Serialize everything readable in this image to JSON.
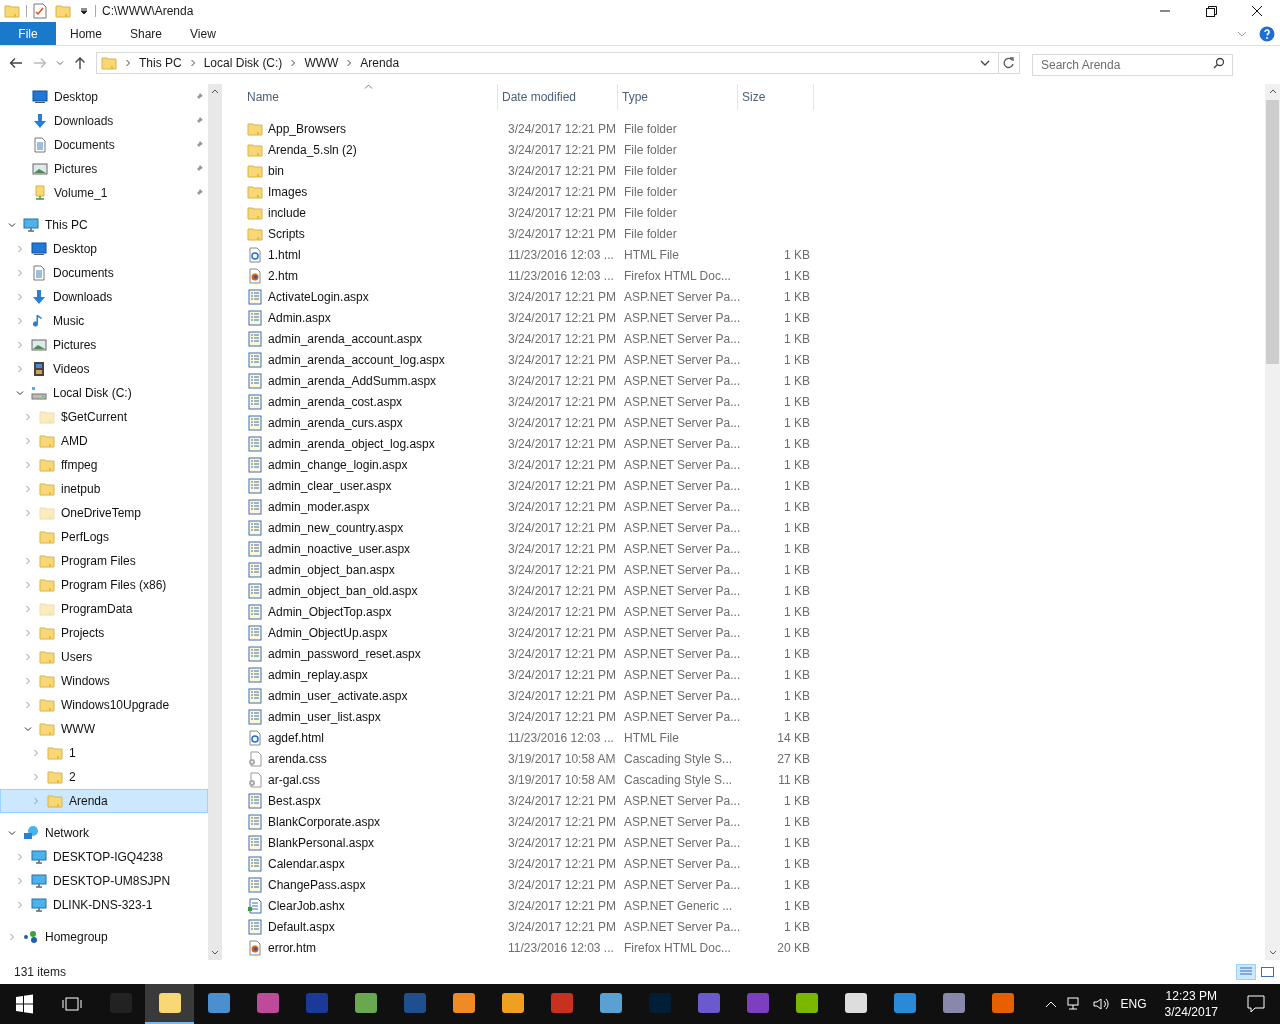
{
  "window": {
    "title": "C:\\WWW\\Arenda"
  },
  "ribbon_tabs": [
    {
      "label": "File",
      "selected": true
    },
    {
      "label": "Home",
      "selected": false
    },
    {
      "label": "Share",
      "selected": false
    },
    {
      "label": "View",
      "selected": false
    }
  ],
  "address": {
    "crumbs": [
      "This PC",
      "Local Disk (C:)",
      "WWW",
      "Arenda"
    ]
  },
  "search": {
    "placeholder": "Search Arenda"
  },
  "quick_access": [
    {
      "label": "Desktop",
      "kind": "desktop",
      "pinned": true
    },
    {
      "label": "Downloads",
      "kind": "downloads",
      "pinned": true
    },
    {
      "label": "Documents",
      "kind": "documents",
      "pinned": true
    },
    {
      "label": "Pictures",
      "kind": "pictures",
      "pinned": true
    },
    {
      "label": "Volume_1",
      "kind": "volume",
      "pinned": true
    }
  ],
  "tree": [
    {
      "label": "This PC",
      "kind": "pc",
      "expanded": true,
      "selected": false,
      "children": [
        {
          "label": "Desktop",
          "kind": "desktop",
          "expanded": false,
          "selected": false
        },
        {
          "label": "Documents",
          "kind": "documents",
          "expanded": false,
          "selected": false
        },
        {
          "label": "Downloads",
          "kind": "downloads",
          "expanded": false,
          "selected": false
        },
        {
          "label": "Music",
          "kind": "music",
          "expanded": false,
          "selected": false
        },
        {
          "label": "Pictures",
          "kind": "pictures",
          "expanded": false,
          "selected": false
        },
        {
          "label": "Videos",
          "kind": "videos",
          "expanded": false,
          "selected": false
        },
        {
          "label": "Local Disk (C:)",
          "kind": "drive",
          "expanded": true,
          "selected": false,
          "children": [
            {
              "label": "$GetCurrent",
              "kind": "folder",
              "hidden": true,
              "expanded": false,
              "selected": false
            },
            {
              "label": "AMD",
              "kind": "folder",
              "hidden": false,
              "expanded": false,
              "selected": false
            },
            {
              "label": "ffmpeg",
              "kind": "folder",
              "hidden": false,
              "expanded": false,
              "selected": false
            },
            {
              "label": "inetpub",
              "kind": "folder",
              "hidden": false,
              "expanded": false,
              "selected": false
            },
            {
              "label": "OneDriveTemp",
              "kind": "folder",
              "hidden": true,
              "expanded": false,
              "selected": false
            },
            {
              "label": "PerfLogs",
              "kind": "folder",
              "hidden": false,
              "selected": false
            },
            {
              "label": "Program Files",
              "kind": "folder",
              "hidden": false,
              "expanded": false,
              "selected": false
            },
            {
              "label": "Program Files (x86)",
              "kind": "folder",
              "hidden": false,
              "expanded": false,
              "selected": false
            },
            {
              "label": "ProgramData",
              "kind": "folder",
              "hidden": true,
              "expanded": false,
              "selected": false
            },
            {
              "label": "Projects",
              "kind": "folder",
              "hidden": false,
              "expanded": false,
              "selected": false
            },
            {
              "label": "Users",
              "kind": "folder",
              "hidden": false,
              "expanded": false,
              "selected": false
            },
            {
              "label": "Windows",
              "kind": "folder",
              "hidden": false,
              "expanded": false,
              "selected": false
            },
            {
              "label": "Windows10Upgrade",
              "kind": "folder",
              "hidden": false,
              "expanded": false,
              "selected": false
            },
            {
              "label": "WWW",
              "kind": "folder",
              "hidden": false,
              "expanded": true,
              "selected": false,
              "children": [
                {
                  "label": "1",
                  "kind": "folder",
                  "hidden": false,
                  "expanded": false,
                  "selected": false
                },
                {
                  "label": "2",
                  "kind": "folder",
                  "hidden": false,
                  "expanded": false,
                  "selected": false
                },
                {
                  "label": "Arenda",
                  "kind": "folder",
                  "hidden": false,
                  "expanded": false,
                  "selected": true
                }
              ]
            }
          ]
        }
      ]
    },
    {
      "label": "Network",
      "kind": "network",
      "expanded": true,
      "selected": false,
      "children": [
        {
          "label": "DESKTOP-IGQ4238",
          "kind": "computer",
          "expanded": false,
          "selected": false
        },
        {
          "label": "DESKTOP-UM8SJPN",
          "kind": "computer",
          "expanded": false,
          "selected": false
        },
        {
          "label": "DLINK-DNS-323-1",
          "kind": "computer",
          "expanded": false,
          "selected": false
        }
      ]
    },
    {
      "label": "Homegroup",
      "kind": "homegroup",
      "expanded": false,
      "selected": false
    }
  ],
  "columns": [
    "Name",
    "Date modified",
    "Type",
    "Size"
  ],
  "files": [
    {
      "kind": "folder",
      "name": "App_Browsers",
      "date": "3/24/2017 12:21 PM",
      "type": "File folder"
    },
    {
      "kind": "folder",
      "name": "Arenda_5.sln (2)",
      "date": "3/24/2017 12:21 PM",
      "type": "File folder"
    },
    {
      "kind": "folder",
      "name": "bin",
      "date": "3/24/2017 12:21 PM",
      "type": "File folder"
    },
    {
      "kind": "folder",
      "name": "Images",
      "date": "3/24/2017 12:21 PM",
      "type": "File folder"
    },
    {
      "kind": "folder",
      "name": "include",
      "date": "3/24/2017 12:21 PM",
      "type": "File folder"
    },
    {
      "kind": "folder",
      "name": "Scripts",
      "date": "3/24/2017 12:21 PM",
      "type": "File folder"
    },
    {
      "kind": "html",
      "name": "1.html",
      "date": "11/23/2016 12:03 ...",
      "type": "HTML File",
      "size": "1 KB"
    },
    {
      "kind": "firefox",
      "name": "2.htm",
      "date": "11/23/2016 12:03 ...",
      "type": "Firefox HTML Doc...",
      "size": "1 KB"
    },
    {
      "kind": "aspx",
      "name": "ActivateLogin.aspx",
      "date": "3/24/2017 12:21 PM",
      "type": "ASP.NET Server Pa...",
      "size": "1 KB"
    },
    {
      "kind": "aspx",
      "name": "Admin.aspx",
      "date": "3/24/2017 12:21 PM",
      "type": "ASP.NET Server Pa...",
      "size": "1 KB"
    },
    {
      "kind": "aspx",
      "name": "admin_arenda_account.aspx",
      "date": "3/24/2017 12:21 PM",
      "type": "ASP.NET Server Pa...",
      "size": "1 KB"
    },
    {
      "kind": "aspx",
      "name": "admin_arenda_account_log.aspx",
      "date": "3/24/2017 12:21 PM",
      "type": "ASP.NET Server Pa...",
      "size": "1 KB"
    },
    {
      "kind": "aspx",
      "name": "admin_arenda_AddSumm.aspx",
      "date": "3/24/2017 12:21 PM",
      "type": "ASP.NET Server Pa...",
      "size": "1 KB"
    },
    {
      "kind": "aspx",
      "name": "admin_arenda_cost.aspx",
      "date": "3/24/2017 12:21 PM",
      "type": "ASP.NET Server Pa...",
      "size": "1 KB"
    },
    {
      "kind": "aspx",
      "name": "admin_arenda_curs.aspx",
      "date": "3/24/2017 12:21 PM",
      "type": "ASP.NET Server Pa...",
      "size": "1 KB"
    },
    {
      "kind": "aspx",
      "name": "admin_arenda_object_log.aspx",
      "date": "3/24/2017 12:21 PM",
      "type": "ASP.NET Server Pa...",
      "size": "1 KB"
    },
    {
      "kind": "aspx",
      "name": "admin_change_login.aspx",
      "date": "3/24/2017 12:21 PM",
      "type": "ASP.NET Server Pa...",
      "size": "1 KB"
    },
    {
      "kind": "aspx",
      "name": "admin_clear_user.aspx",
      "date": "3/24/2017 12:21 PM",
      "type": "ASP.NET Server Pa...",
      "size": "1 KB"
    },
    {
      "kind": "aspx",
      "name": "admin_moder.aspx",
      "date": "3/24/2017 12:21 PM",
      "type": "ASP.NET Server Pa...",
      "size": "1 KB"
    },
    {
      "kind": "aspx",
      "name": "admin_new_country.aspx",
      "date": "3/24/2017 12:21 PM",
      "type": "ASP.NET Server Pa...",
      "size": "1 KB"
    },
    {
      "kind": "aspx",
      "name": "admin_noactive_user.aspx",
      "date": "3/24/2017 12:21 PM",
      "type": "ASP.NET Server Pa...",
      "size": "1 KB"
    },
    {
      "kind": "aspx",
      "name": "admin_object_ban.aspx",
      "date": "3/24/2017 12:21 PM",
      "type": "ASP.NET Server Pa...",
      "size": "1 KB"
    },
    {
      "kind": "aspx",
      "name": "admin_object_ban_old.aspx",
      "date": "3/24/2017 12:21 PM",
      "type": "ASP.NET Server Pa...",
      "size": "1 KB"
    },
    {
      "kind": "aspx",
      "name": "Admin_ObjectTop.aspx",
      "date": "3/24/2017 12:21 PM",
      "type": "ASP.NET Server Pa...",
      "size": "1 KB"
    },
    {
      "kind": "aspx",
      "name": "Admin_ObjectUp.aspx",
      "date": "3/24/2017 12:21 PM",
      "type": "ASP.NET Server Pa...",
      "size": "1 KB"
    },
    {
      "kind": "aspx",
      "name": "admin_password_reset.aspx",
      "date": "3/24/2017 12:21 PM",
      "type": "ASP.NET Server Pa...",
      "size": "1 KB"
    },
    {
      "kind": "aspx",
      "name": "admin_replay.aspx",
      "date": "3/24/2017 12:21 PM",
      "type": "ASP.NET Server Pa...",
      "size": "1 KB"
    },
    {
      "kind": "aspx",
      "name": "admin_user_activate.aspx",
      "date": "3/24/2017 12:21 PM",
      "type": "ASP.NET Server Pa...",
      "size": "1 KB"
    },
    {
      "kind": "aspx",
      "name": "admin_user_list.aspx",
      "date": "3/24/2017 12:21 PM",
      "type": "ASP.NET Server Pa...",
      "size": "1 KB"
    },
    {
      "kind": "html",
      "name": "agdef.html",
      "date": "11/23/2016 12:03 ...",
      "type": "HTML File",
      "size": "14 KB"
    },
    {
      "kind": "css",
      "name": "arenda.css",
      "date": "3/19/2017 10:58 AM",
      "type": "Cascading Style S...",
      "size": "27 KB"
    },
    {
      "kind": "css",
      "name": "ar-gal.css",
      "date": "3/19/2017 10:58 AM",
      "type": "Cascading Style S...",
      "size": "11 KB"
    },
    {
      "kind": "aspx",
      "name": "Best.aspx",
      "date": "3/24/2017 12:21 PM",
      "type": "ASP.NET Server Pa...",
      "size": "1 KB"
    },
    {
      "kind": "aspx",
      "name": "BlankCorporate.aspx",
      "date": "3/24/2017 12:21 PM",
      "type": "ASP.NET Server Pa...",
      "size": "1 KB"
    },
    {
      "kind": "aspx",
      "name": "BlankPersonal.aspx",
      "date": "3/24/2017 12:21 PM",
      "type": "ASP.NET Server Pa...",
      "size": "1 KB"
    },
    {
      "kind": "aspx",
      "name": "Calendar.aspx",
      "date": "3/24/2017 12:21 PM",
      "type": "ASP.NET Server Pa...",
      "size": "1 KB"
    },
    {
      "kind": "aspx",
      "name": "ChangePass.aspx",
      "date": "3/24/2017 12:21 PM",
      "type": "ASP.NET Server Pa...",
      "size": "1 KB"
    },
    {
      "kind": "ashx",
      "name": "ClearJob.ashx",
      "date": "3/24/2017 12:21 PM",
      "type": "ASP.NET Generic ...",
      "size": "1 KB"
    },
    {
      "kind": "aspx",
      "name": "Default.aspx",
      "date": "3/24/2017 12:21 PM",
      "type": "ASP.NET Server Pa...",
      "size": "1 KB"
    },
    {
      "kind": "firefox",
      "name": "error.htm",
      "date": "11/23/2016 12:03 ...",
      "type": "Firefox HTML Doc...",
      "size": "20 KB"
    }
  ],
  "status_bar": {
    "count": "131 items"
  },
  "taskbar": {
    "apps": [
      {
        "kind": "terminal",
        "selected": false
      },
      {
        "kind": "explorer",
        "selected": true
      },
      {
        "kind": "globe",
        "selected": false
      },
      {
        "kind": "shapes",
        "selected": false
      },
      {
        "kind": "disk",
        "selected": false
      },
      {
        "kind": "notepad",
        "selected": false
      },
      {
        "kind": "r",
        "selected": false
      },
      {
        "kind": "blender",
        "selected": false
      },
      {
        "kind": "eye",
        "selected": false
      },
      {
        "kind": "flame",
        "selected": false
      },
      {
        "kind": "tools",
        "selected": false
      },
      {
        "kind": "ps",
        "selected": false
      },
      {
        "kind": "infinity",
        "selected": false
      },
      {
        "kind": "vs",
        "selected": false
      },
      {
        "kind": "vmware",
        "selected": false
      },
      {
        "kind": "calendar",
        "selected": false
      },
      {
        "kind": "bird",
        "selected": false
      },
      {
        "kind": "server",
        "selected": false
      },
      {
        "kind": "firefox",
        "selected": false
      }
    ],
    "language": "ENG",
    "time": "12:23 PM",
    "date": "3/24/2017"
  }
}
